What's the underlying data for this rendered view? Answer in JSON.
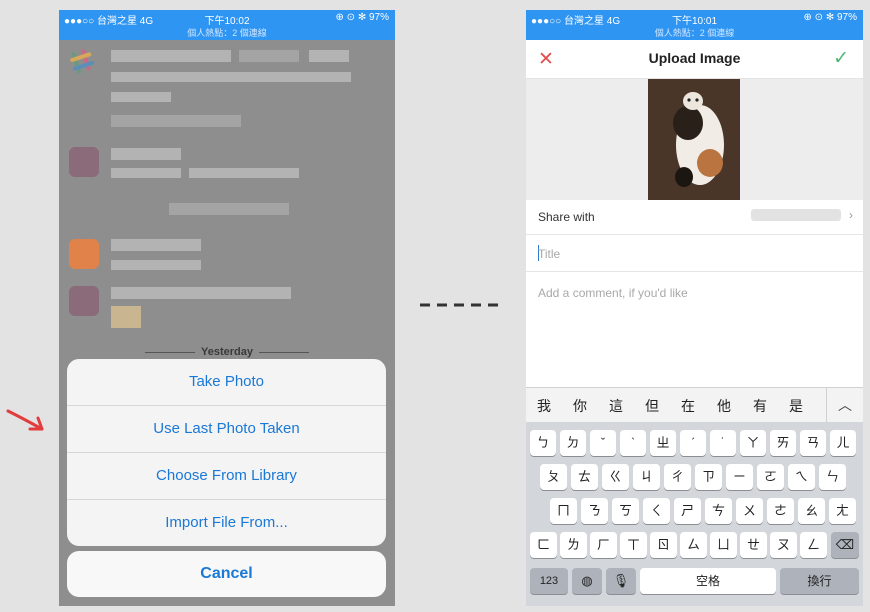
{
  "left_screen": {
    "status_bar": {
      "carrier": "●●●○○ 台灣之星  4G",
      "time": "下午10:02",
      "battery": "⊕ ⊙ ✻ 97%"
    },
    "hotspot_text": "個人熱點：2 個連線",
    "divider_yesterday": "Yesterday",
    "action_sheet": {
      "items": [
        {
          "label": "Take Photo"
        },
        {
          "label": "Use Last Photo Taken"
        },
        {
          "label": "Choose From Library"
        },
        {
          "label": "Import File From..."
        }
      ],
      "cancel": "Cancel"
    }
  },
  "right_screen": {
    "status_bar": {
      "carrier": "●●●○○ 台灣之星  4G",
      "time": "下午10:01",
      "battery": "⊕ ⊙ ✻ 97%"
    },
    "hotspot_text": "個人熱點：2 個連線",
    "header": {
      "title": "Upload Image",
      "close_icon": "close-icon",
      "confirm_icon": "checkmark-icon"
    },
    "share_with": {
      "label": "Share with"
    },
    "title_field": {
      "placeholder": "Title",
      "value": ""
    },
    "comment_field": {
      "placeholder": "Add a comment, if you'd like"
    },
    "keyboard": {
      "candidates": [
        "我",
        "你",
        "這",
        "但",
        "在",
        "他",
        "有",
        "是"
      ],
      "row1": [
        "ㄅ",
        "ㄉ",
        "ˇ",
        "ˋ",
        "ㄓ",
        "ˊ",
        "˙",
        "ㄚ",
        "ㄞ",
        "ㄢ",
        "ㄦ"
      ],
      "row2": [
        "ㄆ",
        "ㄊ",
        "ㄍ",
        "ㄐ",
        "ㄔ",
        "ㄗ",
        "ㄧ",
        "ㄛ",
        "ㄟ",
        "ㄣ"
      ],
      "row3": [
        "ㄇ",
        "ㄋ",
        "ㄎ",
        "ㄑ",
        "ㄕ",
        "ㄘ",
        "ㄨ",
        "ㄜ",
        "ㄠ",
        "ㄤ"
      ],
      "row4": [
        "ㄈ",
        "ㄌ",
        "ㄏ",
        "ㄒ",
        "ㄖ",
        "ㄙ",
        "ㄩ",
        "ㄝ",
        "ㄡ",
        "ㄥ"
      ],
      "numbers_key": "123",
      "space_key": "空格",
      "return_key": "換行"
    }
  },
  "colors": {
    "ios_blue": "#1a78d6",
    "status_bar_blue": "#2f95f3",
    "close_red": "#e05050",
    "confirm_green": "#4fb874"
  }
}
